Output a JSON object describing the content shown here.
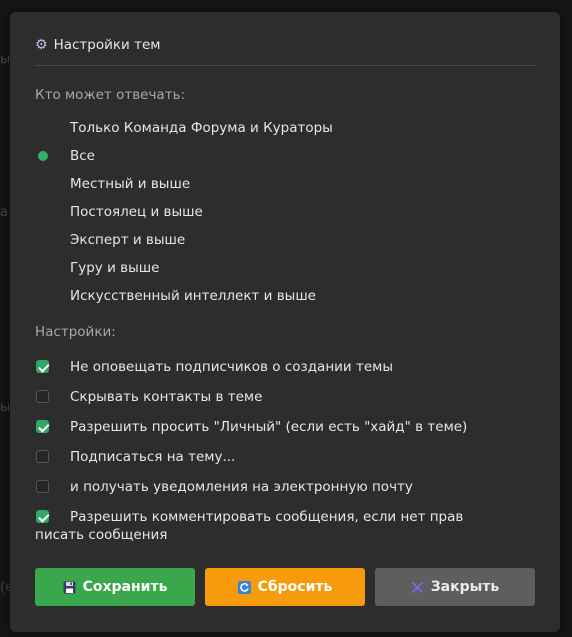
{
  "dialog": {
    "title": "Настройки тем",
    "title_icon": "gear-icon"
  },
  "reply_section": {
    "label": "Кто может отвечать:",
    "options": [
      {
        "label": "Только Команда Форума и Кураторы",
        "selected": false
      },
      {
        "label": "Все",
        "selected": true
      },
      {
        "label": "Местный и выше",
        "selected": false
      },
      {
        "label": "Постоялец и выше",
        "selected": false
      },
      {
        "label": "Эксперт и выше",
        "selected": false
      },
      {
        "label": "Гуру и выше",
        "selected": false
      },
      {
        "label": "Искусственный интеллект и выше",
        "selected": false
      }
    ]
  },
  "settings_section": {
    "label": "Настройки:",
    "options": [
      {
        "label": "Не оповещать подписчиков о создании темы",
        "checked": true
      },
      {
        "label": "Скрывать контакты в теме",
        "checked": false
      },
      {
        "label": "Разрешить просить \"Личный\" (если есть \"хайд\" в теме)",
        "checked": true
      },
      {
        "label": "Подписаться на тему...",
        "checked": false
      },
      {
        "label": "и получать уведомления на электронную почту",
        "checked": false
      },
      {
        "label": "Разрешить комментировать сообщения, если нет прав писать сообщения",
        "checked": true
      }
    ]
  },
  "buttons": {
    "save": {
      "label": "Сохранить",
      "icon": "floppy-disk-icon",
      "color": "#3aa84a"
    },
    "reset": {
      "label": "Сбросить",
      "icon": "refresh-icon",
      "color": "#f59b0c"
    },
    "close": {
      "label": "Закрыть",
      "icon": "close-icon",
      "color": "#5e5e5e"
    }
  },
  "colors": {
    "accent_green": "#2fb36a",
    "dialog_bg": "#2d2d2d"
  }
}
